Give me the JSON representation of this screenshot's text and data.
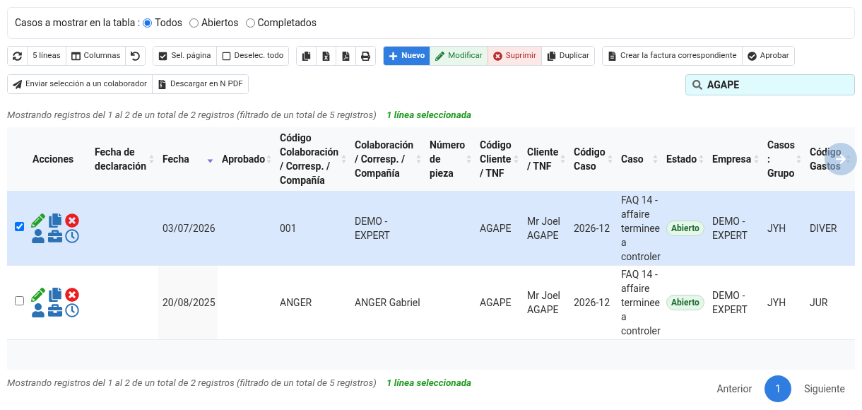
{
  "filter": {
    "label": "Casos a mostrar en la tabla :",
    "options": [
      {
        "label": "Todos",
        "selected": true
      },
      {
        "label": "Abiertos",
        "selected": false
      },
      {
        "label": "Completados",
        "selected": false
      }
    ]
  },
  "toolbar": [
    [
      {
        "kind": "default"
      },
      {
        "kind": "default",
        "label": "5 líneas"
      },
      {
        "kind": "default",
        "label": "Columnas"
      },
      {
        "kind": "default"
      }
    ],
    [
      {
        "kind": "default",
        "label": "Sel. página"
      },
      {
        "kind": "default",
        "label": "Deselec. todo"
      }
    ],
    [
      {
        "kind": "default"
      },
      {
        "kind": "default"
      },
      {
        "kind": "default"
      },
      {
        "kind": "default"
      }
    ],
    [
      {
        "kind": "primary",
        "label": "Nuevo"
      },
      {
        "kind": "success",
        "label": "Modificar"
      },
      {
        "kind": "danger",
        "label": "Suprimir"
      },
      {
        "kind": "default",
        "label": "Duplicar"
      }
    ],
    [
      {
        "kind": "default",
        "label": "Crear la factura correspondiente"
      },
      {
        "kind": "default",
        "label": "Aprobar"
      }
    ],
    [
      {
        "kind": "default",
        "label": "Enviar selección a un colaborador"
      },
      {
        "kind": "default",
        "label": "Descargar en N PDF"
      }
    ]
  ],
  "search": {
    "value": "AGAPE"
  },
  "info_top": {
    "text": "Mostrando registros del 1 al 2 de un total de 2 registros (filtrado de un total de 5 registros)",
    "selection": "1 línea seleccionada"
  },
  "table": {
    "columns": [
      {
        "label": "Acciones",
        "sortable": false,
        "sorted": false
      },
      {
        "label": "Fecha de declaración",
        "sortable": true,
        "sorted": false
      },
      {
        "label": "Fecha",
        "sortable": true,
        "sorted": true
      },
      {
        "label": "Aprobado",
        "sortable": true,
        "sorted": false
      },
      {
        "label": "Código Colaboración / Corresp. / Compañía",
        "sortable": true,
        "sorted": false
      },
      {
        "label": "Colaboración / Corresp. / Compañía",
        "sortable": true,
        "sorted": false
      },
      {
        "label": "Número de pieza",
        "sortable": true,
        "sorted": false
      },
      {
        "label": "Código Cliente / TNF",
        "sortable": true,
        "sorted": false
      },
      {
        "label": "Cliente / TNF",
        "sortable": true,
        "sorted": false
      },
      {
        "label": "Código Caso",
        "sortable": true,
        "sorted": false
      },
      {
        "label": "Caso",
        "sortable": true,
        "sorted": false
      },
      {
        "label": "Estado",
        "sortable": true,
        "sorted": false
      },
      {
        "label": "Empresa",
        "sortable": true,
        "sorted": false
      },
      {
        "label": "Casos : Grupo",
        "sortable": true,
        "sorted": false
      },
      {
        "label": "Código Gastos",
        "sortable": true,
        "sorted": false
      }
    ],
    "rows": [
      {
        "selected": true,
        "checked": true,
        "fecha": "03/07/2026",
        "codigo_colaboracion": "001",
        "colaboracion": "DEMO - EXPERT",
        "codigo_cliente": "AGAPE",
        "cliente": "Mr Joel AGAPE",
        "codigo_caso": "2026-12",
        "caso": "FAQ 14 - affaire terminee a controler",
        "estado": "Abierto",
        "empresa": "DEMO - EXPERT",
        "grupo": "JYH",
        "codigo_gastos": "DIVER"
      },
      {
        "selected": false,
        "checked": false,
        "fecha": "20/08/2025",
        "codigo_colaboracion": "ANGER",
        "colaboracion": "ANGER Gabriel",
        "codigo_cliente": "AGAPE",
        "cliente": "Mr Joel AGAPE",
        "codigo_caso": "2026-12",
        "caso": "FAQ 14 - affaire terminee a controler",
        "estado": "Abierto",
        "empresa": "DEMO - EXPERT",
        "grupo": "JYH",
        "codigo_gastos": "JUR"
      }
    ]
  },
  "info_bottom": {
    "text": "Mostrando registros del 1 al 2 de un total de 2 registros (filtrado de un total de 5 registros)",
    "selection": "1 línea seleccionada"
  },
  "pagination": [
    {
      "label": "Anterior",
      "selected": false
    },
    {
      "label": "1",
      "selected": true
    },
    {
      "label": "Siguiente",
      "selected": false
    }
  ]
}
